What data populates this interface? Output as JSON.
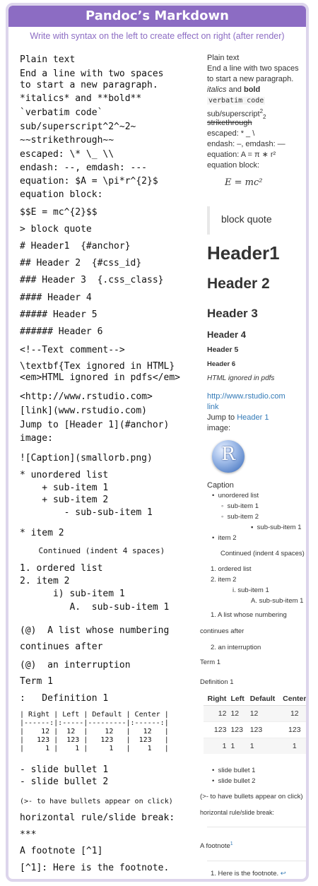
{
  "title": "Pandoc’s Markdown",
  "subtitle": "Write with syntax on the left to create effect on right (after render)",
  "source": {
    "l1": "Plain text",
    "l2": "End a line with two spaces",
    "l3": "to start a new paragraph.",
    "l4": "*italics* and **bold**",
    "l5": "`verbatim code`",
    "l6": "sub/superscript^2^~2~",
    "l7": "~~strikethrough~~",
    "l8": "escaped: \\* \\_ \\\\",
    "l9": "endash: --, emdash: ---",
    "l10": "equation: $A = \\pi*r^{2}$",
    "l11": "equation block:",
    "l12": "$$E = mc^{2}$$",
    "l13": "> block quote",
    "l14": "# Header1  {#anchor}",
    "l15": "## Header 2  {#css_id}",
    "l16": "### Header 3  {.css_class}",
    "l17": "#### Header 4",
    "l18": "##### Header 5",
    "l19": "###### Header 6",
    "l20": "<!--Text comment-->",
    "l21": "\\textbf{Tex ignored in HTML}",
    "l22": "<em>HTML ignored in pdfs</em>",
    "l23": "<http://www.rstudio.com>",
    "l24": "[link](www.rstudio.com)",
    "l25": "Jump to [Header 1](#anchor)",
    "l26": "image:",
    "l27": "![Caption](smallorb.png)",
    "l28": "* unordered list",
    "l29": "    + sub-item 1",
    "l30": "    + sub-item 2",
    "l31": "        - sub-sub-item 1",
    "l32": "* item 2",
    "l33": "    Continued (indent 4 spaces)",
    "l34": "1. ordered list",
    "l35": "2. item 2",
    "l36": "      i) sub-item 1",
    "l37": "         A.  sub-sub-item 1",
    "l38": "(@)  A list whose numbering",
    "l39": "continues after",
    "l40": "(@)  an interruption",
    "l41": "Term 1",
    "l42": ":   Definition 1",
    "l43": "| Right | Left | Default | Center |",
    "l44": "|------:|:-----|---------|:------:|",
    "l45": "|    12 |  12  |    12   |   12   |",
    "l46": "|   123 |  123 |   123   |  123   |",
    "l47": "|     1 |    1 |     1   |    1   |",
    "l48": "- slide bullet 1",
    "l49": "- slide bullet 2",
    "l50": "(>- to have bullets appear on click)",
    "l51": "horizontal rule/slide break:",
    "l52": "***",
    "l53": "A footnote [^1]",
    "l54": "[^1]: Here is the footnote."
  },
  "render": {
    "plain": "Plain text",
    "para1": "End a line with two spaces",
    "para2": "to start a new paragraph.",
    "italics": "italics",
    "and": " and ",
    "bold": "bold",
    "verbatim": "verbatim code",
    "sub_base": "sub/superscript",
    "sup": "2",
    "sub": "2",
    "strike": "strikethrough",
    "escaped": "escaped: * _ \\",
    "dashes": "endash: –, emdash: —",
    "equation": "equation: A = π ∗ r²",
    "eq_block_label": "equation block:",
    "eq_block": "E = mc²",
    "blockquote": "block quote",
    "header1": "Header1",
    "header2": "Header 2",
    "header3": "Header 3",
    "header4": "Header 4",
    "header5": "Header 5",
    "header6": "Header 6",
    "html_ignored": "HTML ignored in pdfs",
    "url": "http://www.rstudio.com",
    "link": "link",
    "jump_prefix": "Jump to ",
    "jump_link": "Header 1",
    "image_label": "image:",
    "logo_letter": "R",
    "caption": "Caption",
    "ul1": "unordered list",
    "ul_sub1": "sub-item 1",
    "ul_sub2": "sub-item 2",
    "ul_subsub1": "sub-sub-item 1",
    "ul_item2": "item 2",
    "continued": "Continued (indent 4 spaces)",
    "ol1": "1.  ordered list",
    "ol2": "2.  item 2",
    "ol_sub": "i.  sub-item 1",
    "ol_subsub": "A.  sub-sub-item 1",
    "numbered1": "1.  A list whose numbering",
    "continues": "continues after",
    "numbered2": "2.  an interruption",
    "term": "Term 1",
    "definition": "Definition 1",
    "table_headers": [
      "Right",
      "Left",
      "Default",
      "Center"
    ],
    "table_rows": [
      [
        "12",
        "12",
        "12",
        "12"
      ],
      [
        "123",
        "123",
        "123",
        "123"
      ],
      [
        "1",
        "1",
        "1",
        "1"
      ]
    ],
    "slide1": "slide bullet 1",
    "slide2": "slide bullet 2",
    "click_note": "(>- to have bullets appear on click)",
    "hr_label": "horizontal rule/slide break:",
    "footnote": "A footnote",
    "footnote_mark": "1",
    "footnote_text": "1. Here is the footnote.",
    "footnote_back": "↩"
  }
}
